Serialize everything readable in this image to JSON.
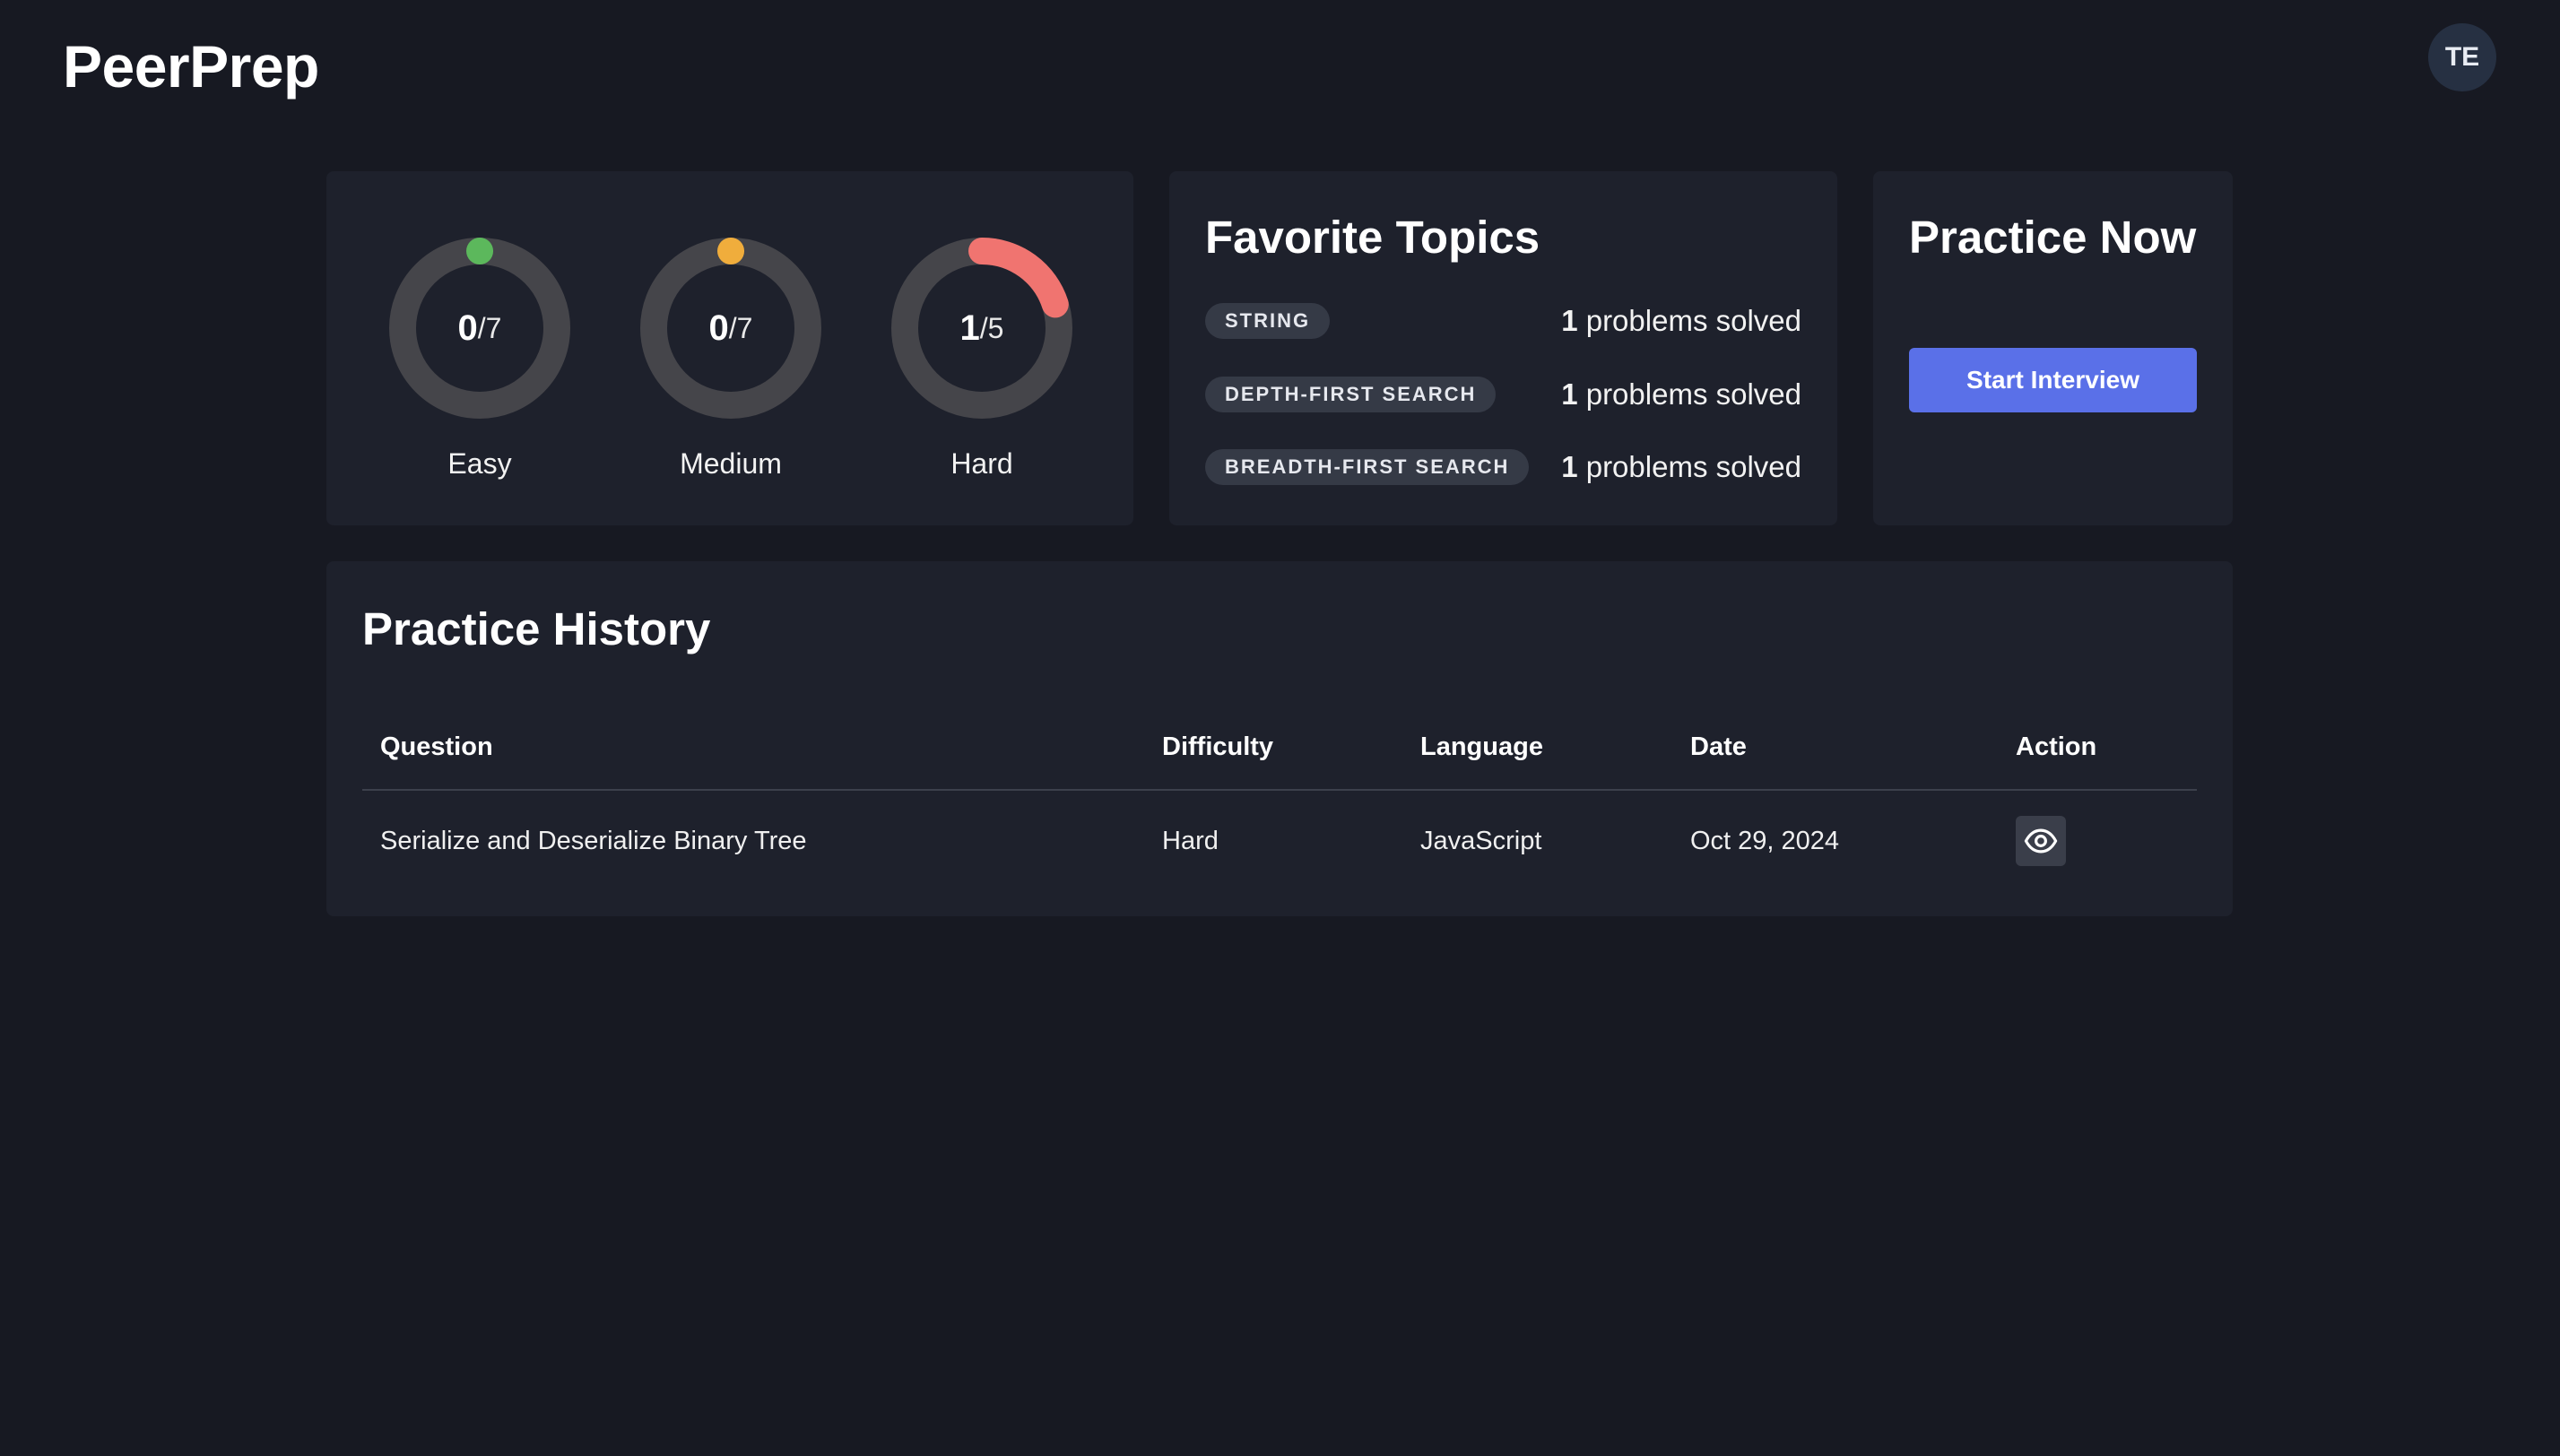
{
  "header": {
    "logo": "PeerPrep",
    "avatar_initials": "TE"
  },
  "progress": [
    {
      "label": "Easy",
      "solved": "0",
      "total": "/7",
      "fraction": 0.0,
      "color": "#5cb85c"
    },
    {
      "label": "Medium",
      "solved": "0",
      "total": "/7",
      "fraction": 0.0,
      "color": "#f0ad3c"
    },
    {
      "label": "Hard",
      "solved": "1",
      "total": "/5",
      "fraction": 0.2,
      "color": "#f07470"
    }
  ],
  "favorite_topics": {
    "title": "Favorite Topics",
    "items": [
      {
        "name": "STRING",
        "count": "1",
        "suffix": "problems solved"
      },
      {
        "name": "DEPTH-FIRST SEARCH",
        "count": "1",
        "suffix": "problems solved"
      },
      {
        "name": "BREADTH-FIRST SEARCH",
        "count": "1",
        "suffix": "problems solved"
      }
    ]
  },
  "practice_now": {
    "title": "Practice Now",
    "button_label": "Start Interview"
  },
  "history": {
    "title": "Practice History",
    "columns": [
      "Question",
      "Difficulty",
      "Language",
      "Date",
      "Action"
    ],
    "rows": [
      {
        "question": "Serialize and Deserialize Binary Tree",
        "difficulty": "Hard",
        "language": "JavaScript",
        "date": "Oct 29, 2024",
        "action_icon": "eye-icon"
      }
    ]
  },
  "colors": {
    "background": "#171922",
    "card": "#1e212c",
    "ring_track": "#45454a",
    "accent_button": "#5a70e8"
  }
}
